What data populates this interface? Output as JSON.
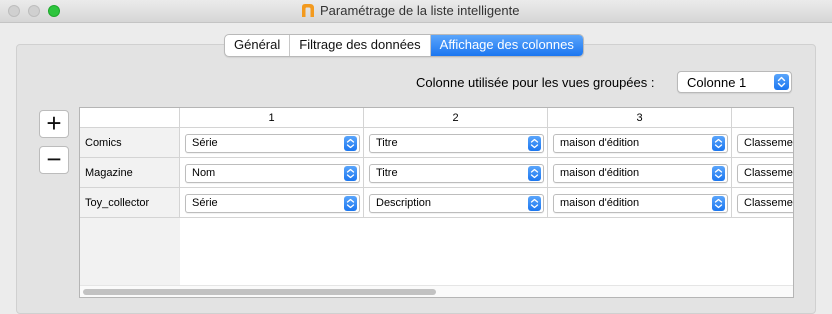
{
  "window": {
    "title": "Paramétrage de la liste intelligente"
  },
  "tabs": [
    {
      "label": "Général",
      "active": false
    },
    {
      "label": "Filtrage des données",
      "active": false
    },
    {
      "label": "Affichage des colonnes",
      "active": true
    }
  ],
  "grouping": {
    "label": "Colonne utilisée pour les vues groupées :",
    "value": "Colonne 1"
  },
  "buttons": {
    "add": "+",
    "remove": "−"
  },
  "table": {
    "columns": [
      "1",
      "2",
      "3"
    ],
    "rows": [
      {
        "name": "Comics",
        "cells": [
          "Série",
          "Titre",
          "maison d'édition",
          "Classemen"
        ]
      },
      {
        "name": "Magazine",
        "cells": [
          "Nom",
          "Titre",
          "maison d'édition",
          "Classemen"
        ]
      },
      {
        "name": "Toy_collector",
        "cells": [
          "Série",
          "Description",
          "maison d'édition",
          "Classemen"
        ]
      }
    ]
  },
  "accent_color": "#1b76f0"
}
